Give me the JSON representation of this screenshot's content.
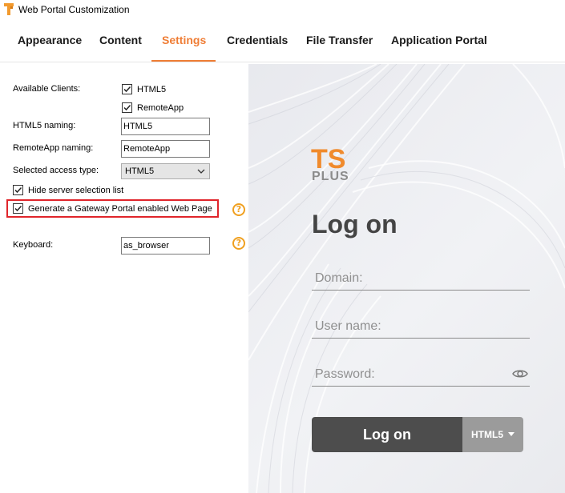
{
  "window": {
    "title": "Web Portal Customization"
  },
  "tabs": [
    {
      "label": "Appearance"
    },
    {
      "label": "Content"
    },
    {
      "label": "Settings"
    },
    {
      "label": "Credentials"
    },
    {
      "label": "File Transfer"
    },
    {
      "label": "Application Portal"
    }
  ],
  "active_tab": "Settings",
  "settings": {
    "available_clients_label": "Available Clients:",
    "client_html5": {
      "label": "HTML5",
      "checked": true
    },
    "client_remoteapp": {
      "label": "RemoteApp",
      "checked": true
    },
    "html5_naming_label": "HTML5 naming:",
    "html5_naming_value": "HTML5",
    "remoteapp_naming_label": "RemoteApp naming:",
    "remoteapp_naming_value": "RemoteApp",
    "access_type_label": "Selected access type:",
    "access_type_value": "HTML5",
    "hide_server_list": {
      "label": "Hide server selection list",
      "checked": true
    },
    "gateway_portal": {
      "label": "Generate a Gateway Portal enabled Web Page",
      "checked": true
    },
    "keyboard_label": "Keyboard:",
    "keyboard_value": "as_browser",
    "help_glyph": "?"
  },
  "preview": {
    "logo_top": "TS",
    "logo_bottom": "PLUS",
    "heading": "Log on",
    "domain_placeholder": "Domain:",
    "username_placeholder": "User name:",
    "password_placeholder": "Password:",
    "logon_button": "Log on",
    "client_select": "HTML5",
    "icons": [
      "eye-icon",
      "dropdown-caret-icon"
    ]
  },
  "colors": {
    "accent": "#ef7d35",
    "highlight": "#e0252b",
    "help": "#f0a020",
    "button_dark": "#4d4d4d",
    "button_light": "#9b9b9b"
  }
}
